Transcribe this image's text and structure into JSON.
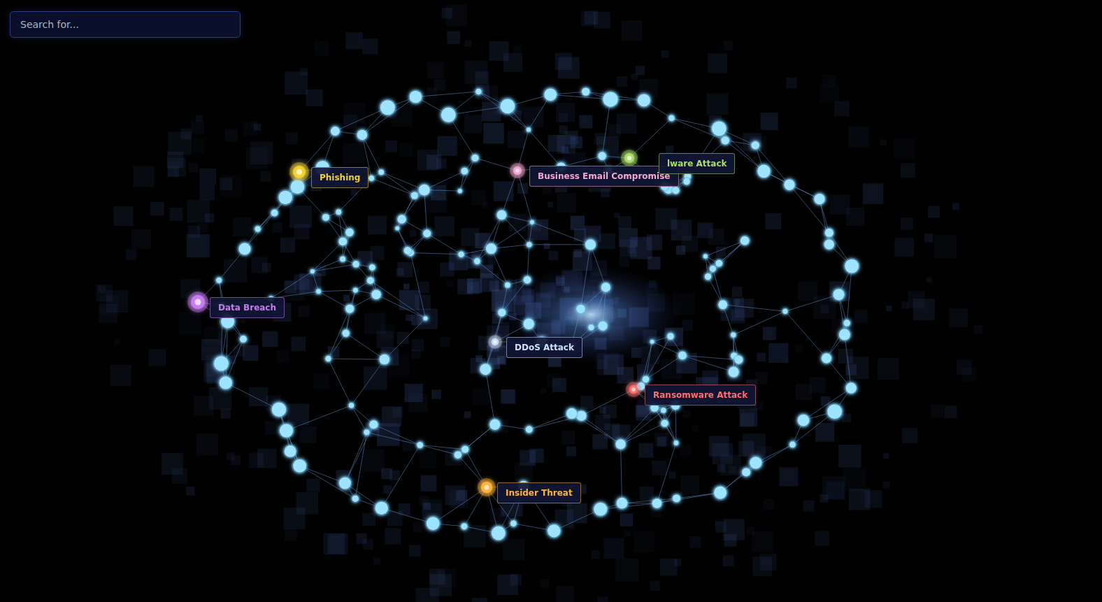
{
  "search": {
    "placeholder": "Search for..."
  },
  "graph": {
    "nodes": [
      {
        "label": "Phishing",
        "color": "#f2d22e"
      },
      {
        "label": "Business Email Compromise",
        "color": "#f4a6cf"
      },
      {
        "label": "lware Attack",
        "color": "#a9de6a"
      },
      {
        "label": "Data Breach",
        "color": "#c77cf2"
      },
      {
        "label": "DDoS Attack",
        "color": "#cfe0ff"
      },
      {
        "label": "Ransomware Attack",
        "color": "#ff6f6f"
      },
      {
        "label": "Insider Threat",
        "color": "#ffb436"
      }
    ]
  }
}
